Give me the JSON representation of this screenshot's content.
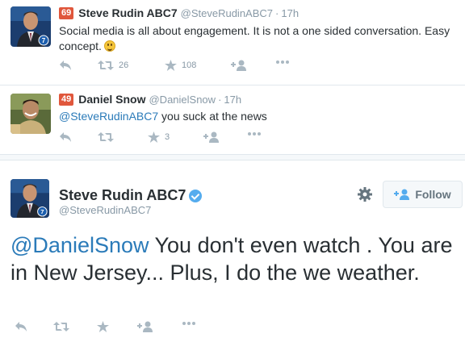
{
  "tweets": [
    {
      "score": "69",
      "name": "Steve Rudin ABC7",
      "handle": "@SteveRudinABC7",
      "dot": "·",
      "time": "17h",
      "text": "Social media is all about engagement. It is not a one sided conversation. Easy concept.",
      "retweets": "26",
      "favorites": "108"
    },
    {
      "score": "49",
      "name": "Daniel Snow",
      "handle": "@DanielSnow",
      "dot": "·",
      "time": "17h",
      "mention": "@SteveRudinABC7",
      "text": " you suck at the news",
      "retweets": "",
      "favorites": "3"
    }
  ],
  "main": {
    "name": "Steve Rudin ABC7",
    "handle": "@SteveRudinABC7",
    "follow_label": "Follow",
    "mention": "@DanielSnow",
    "text": " You don't even watch . You are in New Jersey... Plus, I do the we weather."
  },
  "icons": {
    "reply": "reply-icon",
    "retweet": "retweet-icon",
    "favorite": "star-icon",
    "follow": "follow-user-icon",
    "more": "more-dots-icon",
    "gear": "gear-icon",
    "verified": "verified-badge-icon"
  },
  "colors": {
    "score_badge": "#e0573c",
    "link": "#2b7bb9",
    "muted": "#8899a6",
    "icon": "#aab8c2",
    "verified": "#55acee"
  }
}
